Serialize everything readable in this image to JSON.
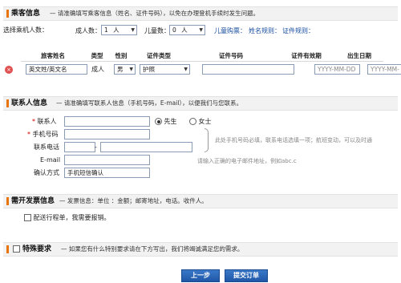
{
  "passenger": {
    "title": "乘客信息",
    "desc": "— 请准确填写乘客信息（姓名、证件号码），以免在办理登机手续时发生问题。",
    "select_count_label": "选择乘机人数：",
    "adult_label": "成人数：",
    "adult_value": "1",
    "adult_unit": "人",
    "child_label": "儿童数：",
    "child_value": "0",
    "child_unit": "人",
    "links": [
      "儿童购票：",
      "姓名规则：",
      "证件规则："
    ],
    "columns": [
      "旅客姓名",
      "类型",
      "性别",
      "证件类型",
      "证件号码",
      "证件有效期",
      "出生日期"
    ],
    "row": {
      "name": "英文姓/英文名",
      "type": "成人",
      "gender": "男",
      "id_type": "护照",
      "id_number": "",
      "expiry_placeholder": "YYYY-MM-DD",
      "birth_placeholder": "YYYY-MM-"
    }
  },
  "contact": {
    "title": "联系人信息",
    "desc": "— 请准确填写联系人信息（手机号码，E-mail），以便我们与您联系。",
    "name_label": "联系人",
    "mobile_label": "手机号码",
    "phone_label": "联系电话",
    "email_label": "E-mail",
    "confirm_label": "确认方式",
    "confirm_value": "手机短信确认",
    "mr_label": "先生",
    "ms_label": "女士",
    "note_phone": "此处手机号码必填，联系电话选填一项；航班变动，可以及时通",
    "note_email": "请输入正确的电子邮件地址，例如abc.c",
    "phone_dash": "-"
  },
  "invoice": {
    "title": "需开发票信息",
    "desc": "— 发票信息：单位 ：金额；邮寄地址，电话。收件人。",
    "checkbox_label": "配送行程单，我需要报销。"
  },
  "special": {
    "title": "特殊要求",
    "desc": "— 如果您有什么特别要求请在下方写出，我们将竭诚满足您的需求。"
  },
  "buttons": {
    "prev": "上一步",
    "submit": "提交订单"
  },
  "colors": {
    "accent_bar": "#e8740c",
    "button": "#1f56a8",
    "link": "#1a4fa0",
    "delete_icon": "#e05050"
  }
}
